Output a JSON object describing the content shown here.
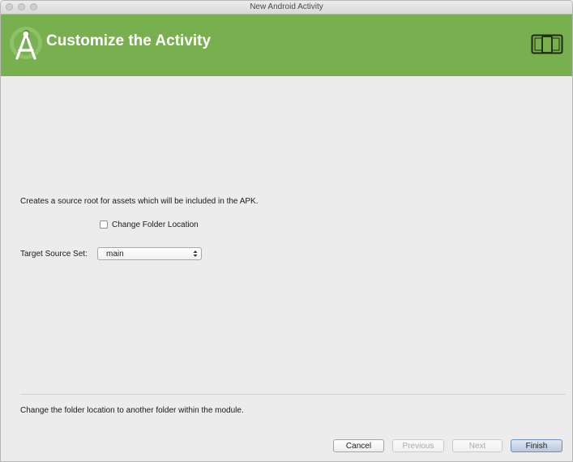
{
  "window": {
    "title": "New Android Activity"
  },
  "header": {
    "title": "Customize the Activity",
    "logo_icon": "android-studio-icon",
    "device_icon": "device-icon",
    "background_color": "#78b04f"
  },
  "content": {
    "description": "Creates a source root for assets which will be included in the APK.",
    "change_folder": {
      "label": "Change Folder Location",
      "checked": false
    },
    "target_source_set": {
      "label": "Target Source Set:",
      "value": "main"
    },
    "hint": "Change the folder location to another folder within the module."
  },
  "buttons": {
    "cancel": "Cancel",
    "previous": "Previous",
    "next": "Next",
    "finish": "Finish"
  }
}
